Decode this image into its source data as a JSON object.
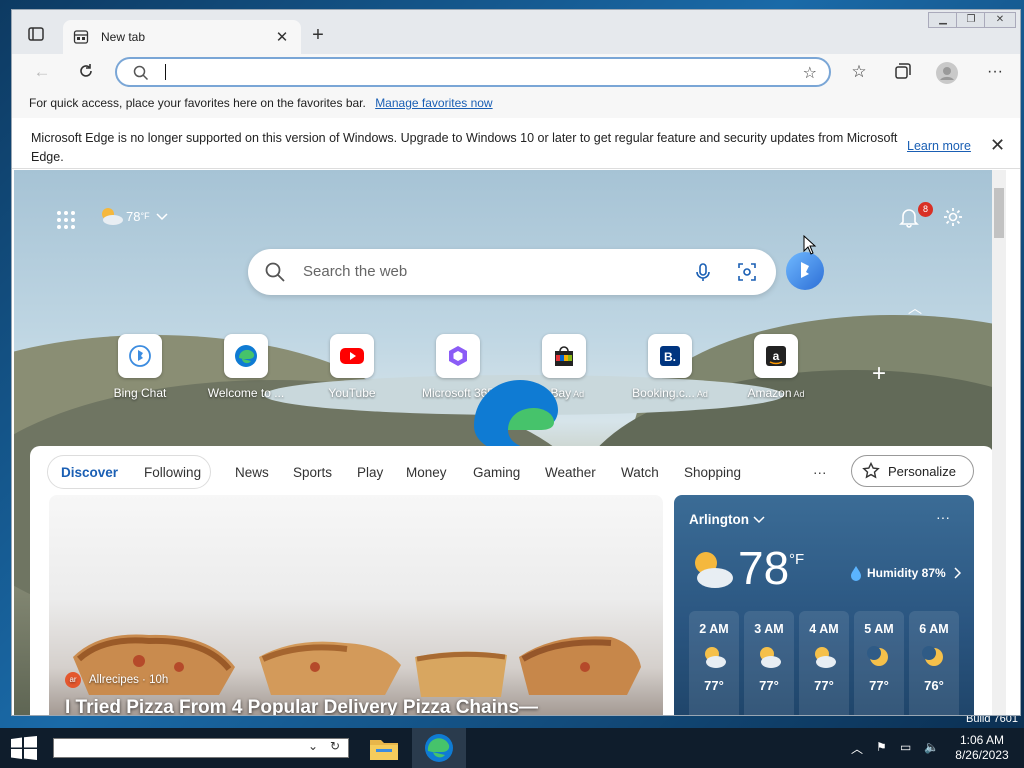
{
  "browser": {
    "tab_title": "New tab",
    "address_value": "",
    "favbar_text": "For quick access, place your favorites here on the favorites bar.",
    "favbar_link": "Manage favorites now",
    "info_message": "Microsoft Edge is no longer supported on this version of Windows. Upgrade to Windows 10 or later to get regular feature and security updates from Microsoft Edge.",
    "info_link": "Learn more"
  },
  "ntp": {
    "weather_temp": "78",
    "weather_unit": "°F",
    "notification_count": "8",
    "search_placeholder": "Search the web",
    "tiles": [
      {
        "label": "Bing Chat",
        "ad": ""
      },
      {
        "label": "Welcome to ...",
        "ad": ""
      },
      {
        "label": "YouTube",
        "ad": ""
      },
      {
        "label": "Microsoft 365",
        "ad": ""
      },
      {
        "label": "eBay",
        "ad": "Ad"
      },
      {
        "label": "Booking.c...",
        "ad": "Ad"
      },
      {
        "label": "Amazon",
        "ad": "Ad"
      }
    ],
    "tile_icon_names": [
      "bing-chat-icon",
      "edge-icon",
      "youtube-icon",
      "microsoft-365-icon",
      "ebay-icon",
      "booking-icon",
      "amazon-icon"
    ]
  },
  "feed": {
    "segments": [
      "Discover",
      "Following"
    ],
    "nav": [
      "News",
      "Sports",
      "Play",
      "Money",
      "Gaming",
      "Weather",
      "Watch",
      "Shopping"
    ],
    "more": "···",
    "personalize": "Personalize",
    "hero": {
      "source": "Allrecipes · 10h",
      "source_logo": "ar",
      "headline": "I Tried Pizza From 4 Popular Delivery Pizza Chains—"
    },
    "weather": {
      "location": "Arlington",
      "more": "···",
      "temp": "78",
      "unit": "°F",
      "humidity": "Humidity 87%",
      "hourly": [
        {
          "hour": "2 AM",
          "temp": "77°",
          "icon": "partly-cloudy-night-icon"
        },
        {
          "hour": "3 AM",
          "temp": "77°",
          "icon": "partly-cloudy-night-icon"
        },
        {
          "hour": "4 AM",
          "temp": "77°",
          "icon": "partly-cloudy-night-icon"
        },
        {
          "hour": "5 AM",
          "temp": "77°",
          "icon": "moon-icon"
        },
        {
          "hour": "6 AM",
          "temp": "76°",
          "icon": "moon-icon"
        }
      ]
    }
  },
  "os": {
    "build": "Build 7601",
    "time": "1:06 AM",
    "date": "8/26/2023",
    "taskbar_search_value": ""
  },
  "colors": {
    "accent": "#1a5fb4",
    "taskbar": "#0f1d2c",
    "weather_card": "#2a5580"
  }
}
